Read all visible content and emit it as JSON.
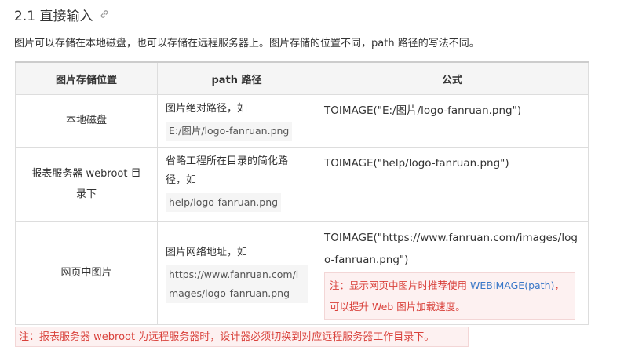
{
  "heading": {
    "text": "2.1 直接输入"
  },
  "intro": "图片可以存储在本地磁盘，也可以存储在远程服务器上。图片存储的位置不同，path 路径的写法不同。",
  "table": {
    "headers": [
      "图片存储位置",
      "path 路径",
      "公式"
    ],
    "rows": [
      {
        "location": "本地磁盘",
        "path_desc": "图片绝对路径，如",
        "path_code": "E:/图片/logo-fanruan.png",
        "formula": "TOIMAGE(\"E:/图片/logo-fanruan.png\")"
      },
      {
        "location": "报表服务器 webroot 目录下",
        "path_desc": "省略工程所在目录的简化路径，如",
        "path_code": "help/logo-fanruan.png",
        "formula": "TOIMAGE(\"help/logo-fanruan.png\")"
      },
      {
        "location": "网页中图片",
        "path_desc": "图片网络地址，如",
        "path_code": "https://www.fanruan.com/images/logo-fanruan.png",
        "formula": "TOIMAGE(\"https://www.fanruan.com/images/logo-fanruan.png\")",
        "note": {
          "prefix": "注：显示网页中图片时推荐使用 ",
          "link": "WEBIMAGE(path)",
          "suffix": "，可以提升 Web 图片加载速度。"
        }
      }
    ]
  },
  "bottom_note": "注：报表服务器 webroot 为远程服务器时，设计器必须切换到对应远程服务器工作目录下。",
  "colors": {
    "note_text": "#d9413b",
    "note_bg": "#fdf1f1",
    "link": "#3a78c8"
  },
  "icons": {
    "heading_anchor": "link-icon"
  }
}
